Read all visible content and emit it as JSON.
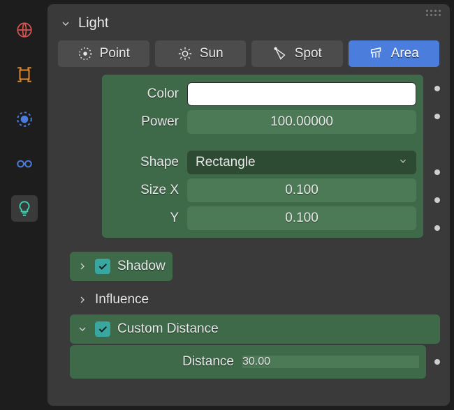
{
  "header": {
    "title": "Light"
  },
  "light_types": [
    {
      "id": "point",
      "label": "Point",
      "active": false
    },
    {
      "id": "sun",
      "label": "Sun",
      "active": false
    },
    {
      "id": "spot",
      "label": "Spot",
      "active": false
    },
    {
      "id": "area",
      "label": "Area",
      "active": true
    }
  ],
  "props": {
    "color_label": "Color",
    "color_value_hex": "#ffffff",
    "power_label": "Power",
    "power_value": "100.00000",
    "shape_label": "Shape",
    "shape_value": "Rectangle",
    "sizex_label": "Size X",
    "sizex_value": "0.100",
    "sizey_label": "Y",
    "sizey_value": "0.100"
  },
  "subpanels": {
    "shadow_label": "Shadow",
    "shadow_checked": true,
    "influence_label": "Influence",
    "custom_distance_label": "Custom Distance",
    "custom_distance_checked": true
  },
  "distance": {
    "label": "Distance",
    "value": "30.00"
  },
  "colors": {
    "accent_blue": "#4b7ddd",
    "highlight_green": "#3f6a4a",
    "field_green": "#4d7a56",
    "select_green": "#2d4a33",
    "teal_check": "#3aa6a0"
  }
}
